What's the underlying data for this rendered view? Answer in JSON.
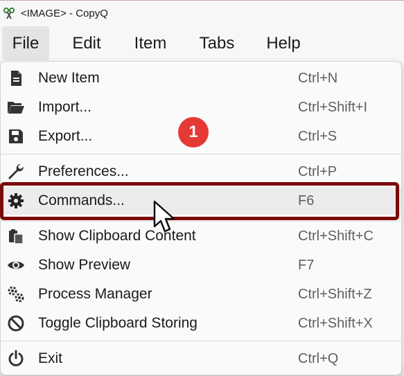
{
  "window": {
    "title": "<IMAGE> - CopyQ",
    "app_icon": "scissors-icon"
  },
  "menubar": {
    "items": [
      {
        "label": "File",
        "active": true
      },
      {
        "label": "Edit"
      },
      {
        "label": "Item"
      },
      {
        "label": "Tabs"
      },
      {
        "label": "Help"
      }
    ]
  },
  "file_menu": {
    "items": [
      {
        "label": "New Item",
        "shortcut": "Ctrl+N",
        "icon": "document-icon"
      },
      {
        "label": "Import...",
        "shortcut": "Ctrl+Shift+I",
        "icon": "folder-open-icon"
      },
      {
        "label": "Export...",
        "shortcut": "Ctrl+S",
        "icon": "save-icon"
      },
      {
        "label": "Preferences...",
        "shortcut": "Ctrl+P",
        "icon": "wrench-icon"
      },
      {
        "label": "Commands...",
        "shortcut": "F6",
        "icon": "gear-icon",
        "highlighted": true
      },
      {
        "label": "Show Clipboard Content",
        "shortcut": "Ctrl+Shift+C",
        "icon": "clipboard-icon"
      },
      {
        "label": "Show Preview",
        "shortcut": "F7",
        "icon": "eye-icon"
      },
      {
        "label": "Process Manager",
        "shortcut": "Ctrl+Shift+Z",
        "icon": "gears-icon"
      },
      {
        "label": "Toggle Clipboard Storing",
        "shortcut": "Ctrl+Shift+X",
        "icon": "ban-icon"
      },
      {
        "label": "Exit",
        "shortcut": "Ctrl+Q",
        "icon": "power-icon"
      }
    ]
  },
  "annotation": {
    "step_number": "1",
    "highlight_color": "#7b0a0a",
    "callout_color": "#e53935"
  }
}
